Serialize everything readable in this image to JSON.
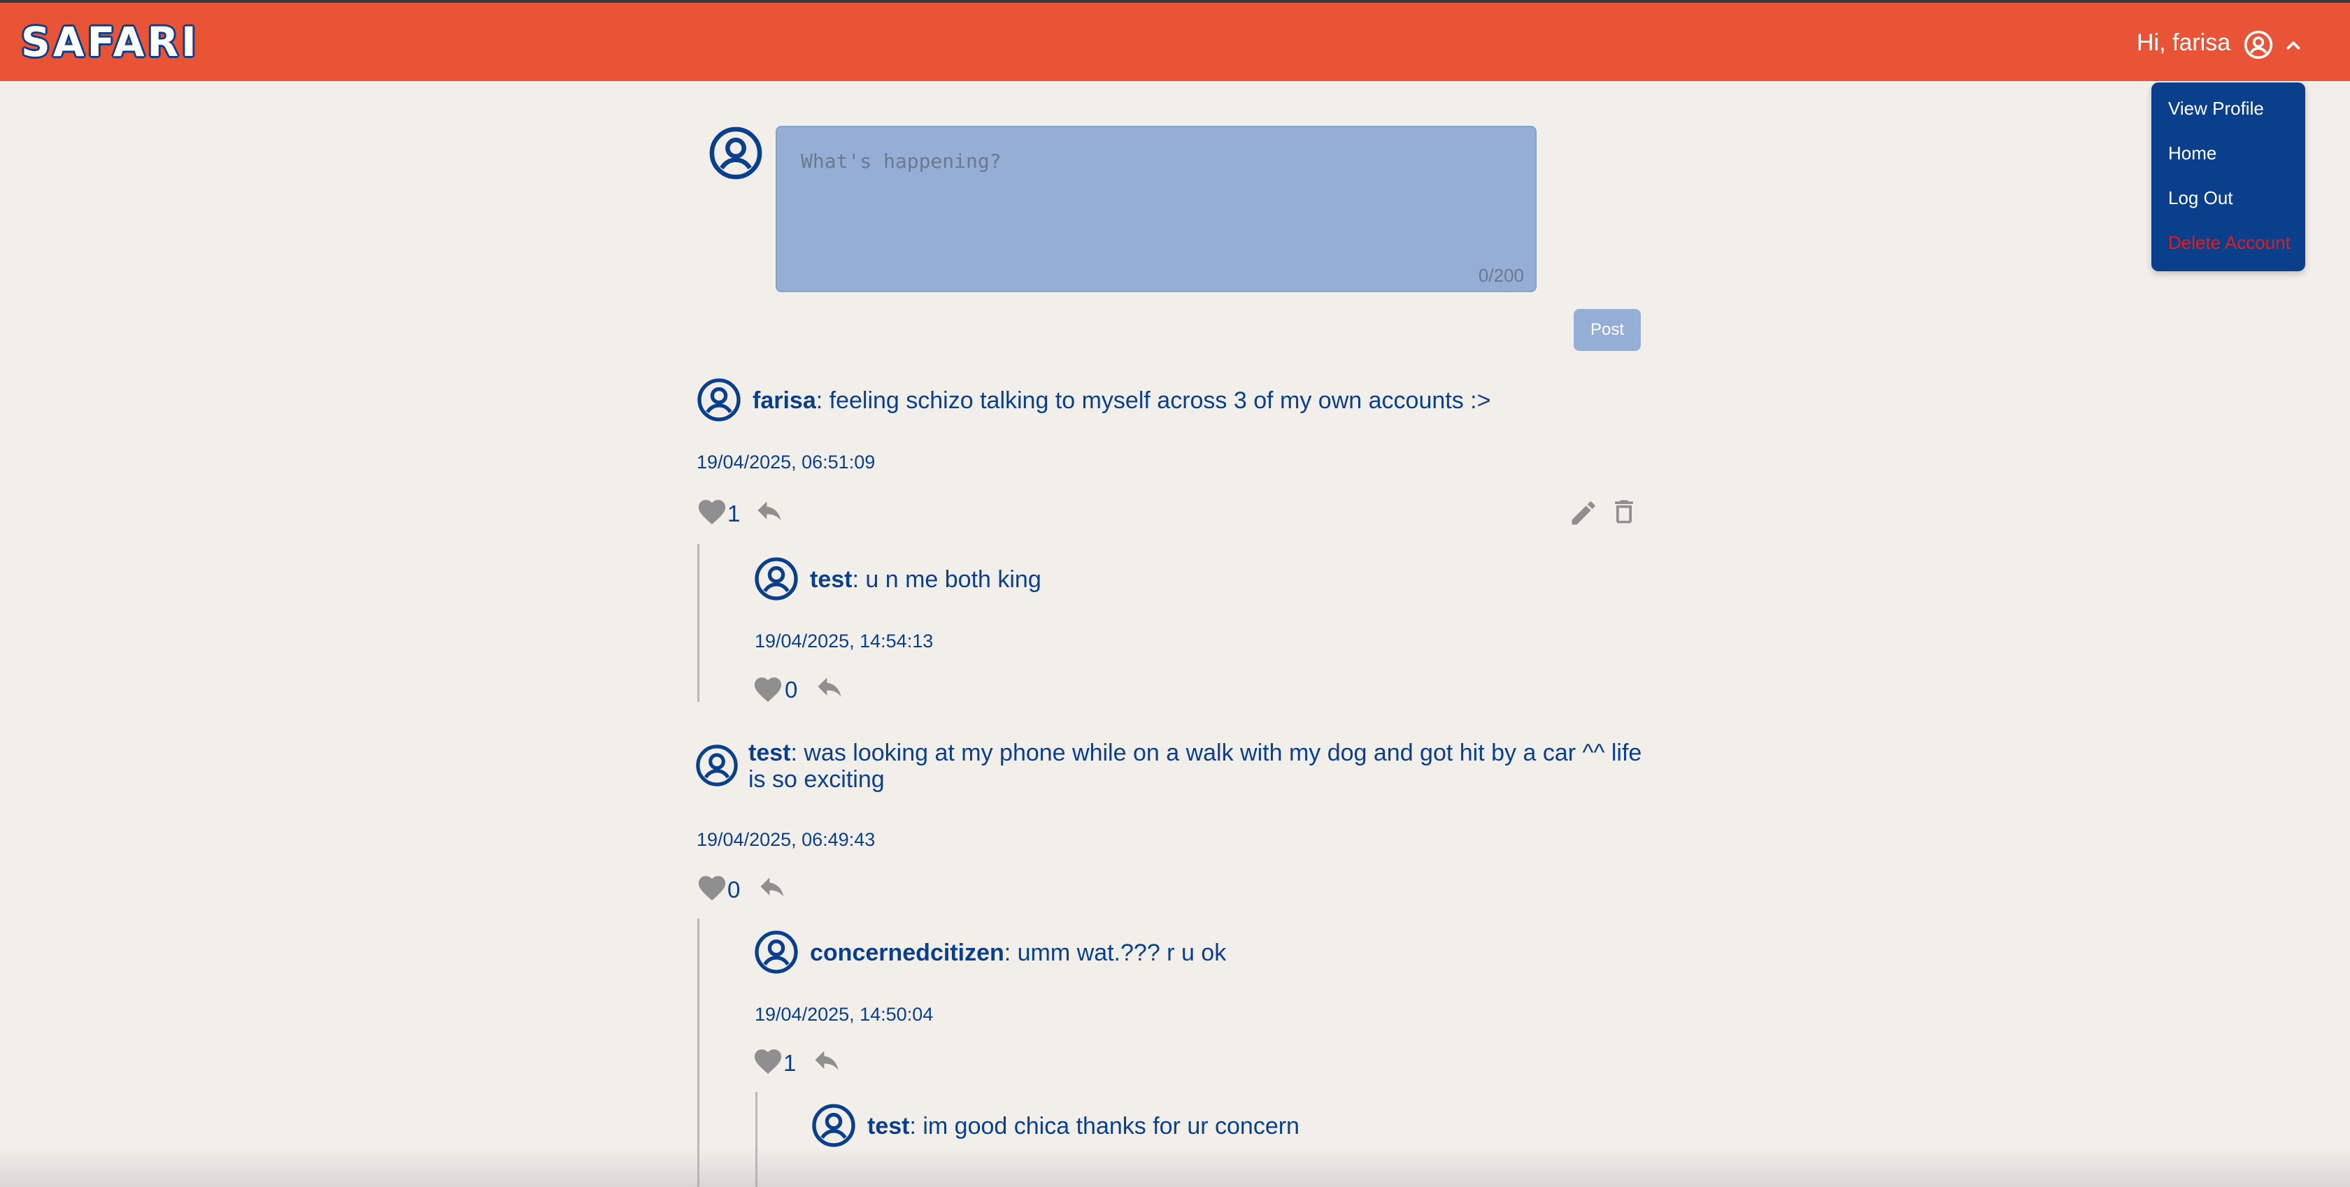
{
  "app": {
    "logo": "SAFARI"
  },
  "header": {
    "greeting": "Hi, farisa"
  },
  "menu": {
    "items": [
      "View Profile",
      "Home",
      "Log Out",
      "Delete Account"
    ]
  },
  "composer": {
    "placeholder": "What's happening?",
    "counter": "0/200",
    "post_label": "Post"
  },
  "posts": [
    {
      "user": "farisa",
      "text": ": feeling schizo talking to myself across 3 of my own accounts :>",
      "time": "19/04/2025, 06:51:09",
      "likes": "1"
    },
    {
      "user": "test",
      "text": ": u n me both king",
      "time": "19/04/2025, 14:54:13",
      "likes": "0"
    },
    {
      "user": "test",
      "text": ": was looking at my phone while on a walk with my dog and got hit by a car ^^ life is so exciting",
      "time": "19/04/2025, 06:49:43",
      "likes": "0"
    },
    {
      "user": "concernedcitizen",
      "text": ": umm wat.??? r u ok",
      "time": "19/04/2025, 14:50:04",
      "likes": "1"
    },
    {
      "user": "test",
      "text": ": im good chica thanks for ur concern"
    }
  ],
  "colors": {
    "brand": "#e95436",
    "primary": "#0a3f8c",
    "background": "#f2efeb",
    "danger": "#e41b1b"
  }
}
